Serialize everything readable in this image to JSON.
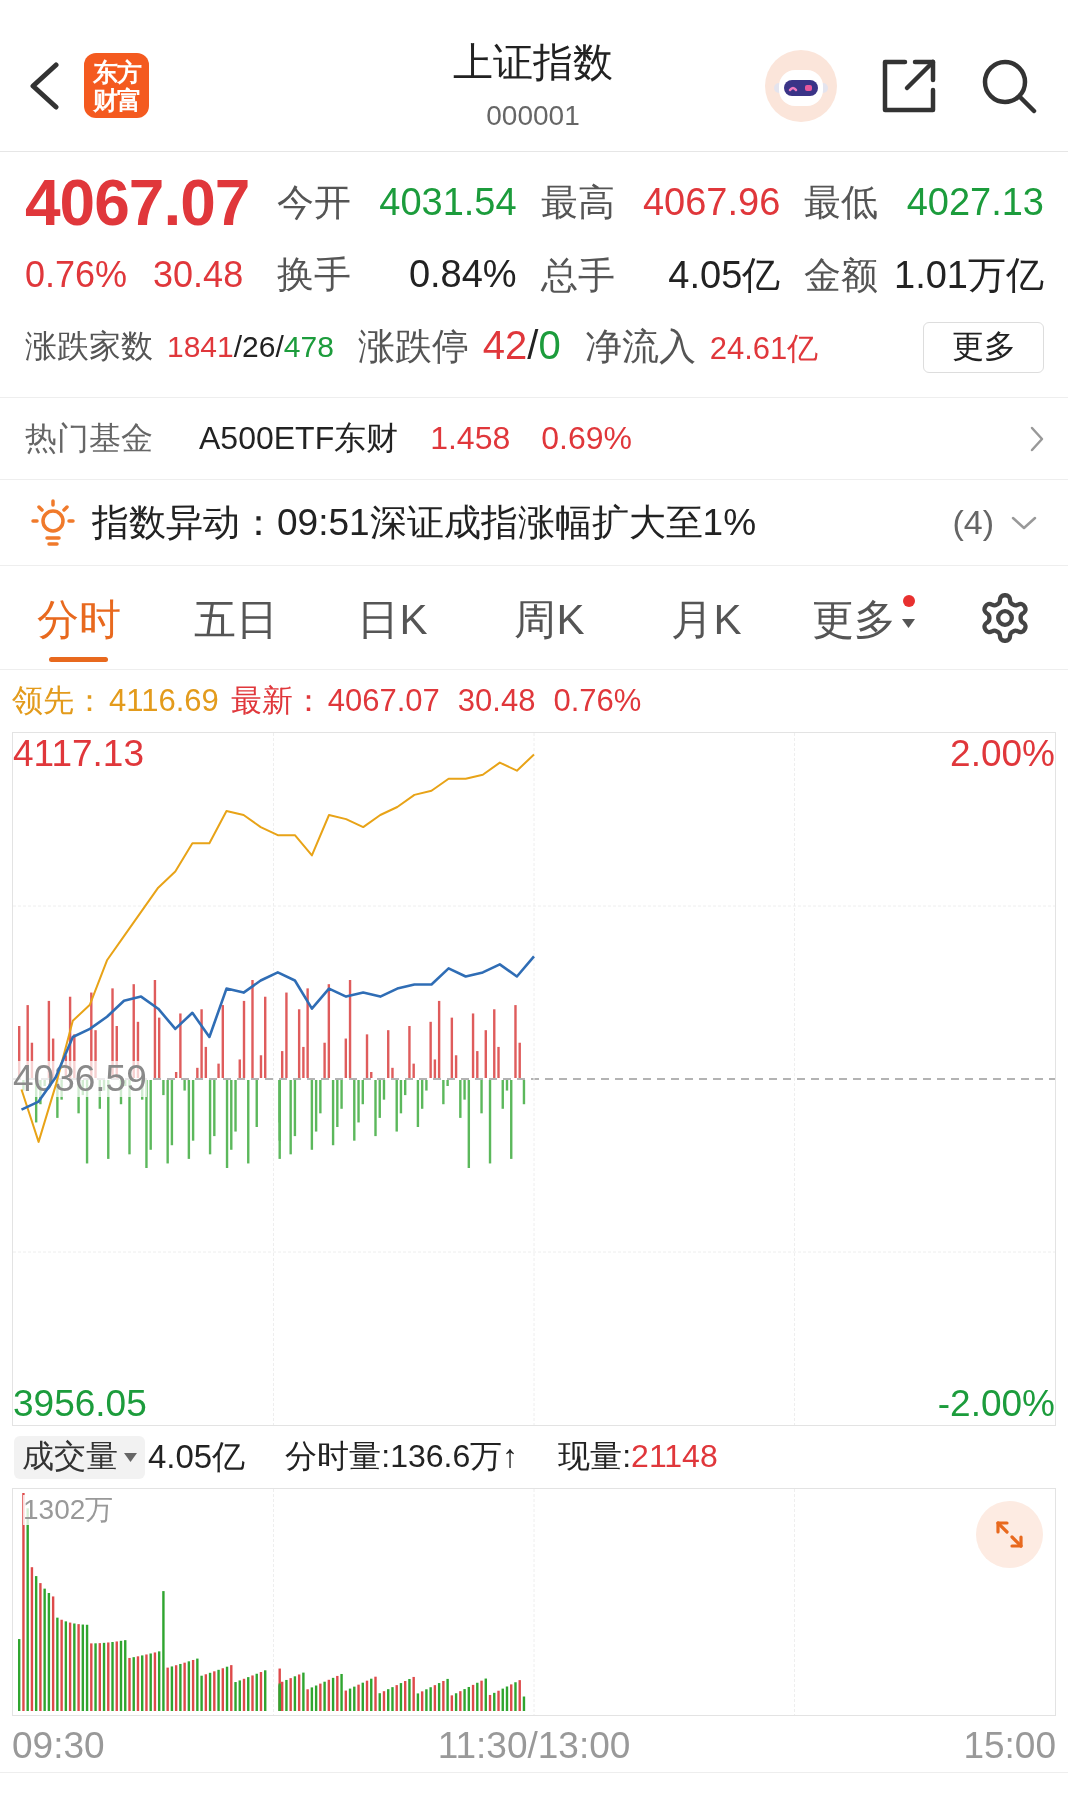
{
  "header": {
    "logo": [
      "东方",
      "财富"
    ],
    "title": "上证指数",
    "code": "000001"
  },
  "quote": {
    "price": "4067.07",
    "change_pct": "0.76%",
    "change": "30.48",
    "color": "#e0373b",
    "stats": [
      {
        "label": "今开",
        "value": "4031.54",
        "color": "#1c9c3c"
      },
      {
        "label": "最高",
        "value": "4067.96",
        "color": "#e0373b"
      },
      {
        "label": "最低",
        "value": "4027.13",
        "color": "#1c9c3c"
      },
      {
        "label": "换手",
        "value": "0.84%",
        "color": "#222222"
      },
      {
        "label": "总手",
        "value": "4.05亿",
        "color": "#222222"
      },
      {
        "label": "金额",
        "value": "1.01万亿",
        "color": "#222222"
      }
    ],
    "breadth": [
      {
        "label": "涨跌家数",
        "parts": [
          {
            "text": "1841",
            "color": "#e0373b"
          },
          {
            "text": "/26/",
            "color": "#222222"
          },
          {
            "text": "478",
            "color": "#1c9c3c"
          }
        ]
      },
      {
        "label": "涨跌停",
        "parts": [
          {
            "text": "42",
            "color": "#e0373b"
          },
          {
            "text": "/",
            "color": "#222222"
          },
          {
            "text": "0",
            "color": "#1c9c3c"
          }
        ]
      },
      {
        "label": "净流入",
        "parts": [
          {
            "text": "24.61亿",
            "color": "#e0373b"
          }
        ]
      }
    ],
    "more_button": "更多"
  },
  "hot_fund": {
    "label": "热门基金",
    "name": "A500ETF东财",
    "price": "1.458",
    "change": "0.69%",
    "color": "#e0373b"
  },
  "alert": {
    "text": "指数异动：09:51深证成指涨幅扩大至1%",
    "count": "(4)",
    "expanded": false
  },
  "tabs": [
    {
      "label": "分时",
      "kind": "view",
      "selected": true,
      "notice": false
    },
    {
      "label": "五日",
      "kind": "view",
      "selected": false,
      "notice": false
    },
    {
      "label": "日K",
      "kind": "view",
      "selected": false,
      "notice": false
    },
    {
      "label": "周K",
      "kind": "view",
      "selected": false,
      "notice": false
    },
    {
      "label": "月K",
      "kind": "view",
      "selected": false,
      "notice": false
    },
    {
      "label": "更多",
      "kind": "menu",
      "selected": false,
      "notice": true
    }
  ],
  "chart": {
    "legend": [
      {
        "values": [
          "4116.69"
        ],
        "color": "#e39b1c"
      },
      {
        "values": [
          "4067.07",
          "30.48",
          "0.76%"
        ],
        "color": "#e0373b"
      }
    ],
    "chart_data": {
      "type": "line",
      "categories": [
        null,
        null,
        null,
        null,
        null,
        null,
        null,
        null,
        null,
        null,
        null,
        null,
        null,
        null,
        null,
        null,
        null,
        null,
        null,
        null,
        null,
        null,
        null,
        null,
        null,
        null,
        null,
        null,
        null,
        null,
        null,
        null,
        null,
        null,
        null,
        null,
        null,
        null,
        null,
        null,
        null,
        null,
        null,
        null,
        null,
        null,
        null,
        null,
        null,
        null,
        null,
        null,
        null,
        null,
        null,
        null,
        null,
        null,
        null,
        null,
        null
      ],
      "series": [
        {
          "name": "领先：",
          "color": "#e8a317",
          "values": [
            4034,
            4021,
            4035,
            4051,
            4055,
            4066,
            4072,
            4078,
            4084,
            4088,
            4095,
            4095,
            4103,
            4102,
            4099,
            4097,
            4097,
            4092,
            4102,
            4101,
            4099,
            4102,
            4104,
            4107,
            4108,
            4111,
            4111,
            4112,
            4115,
            4113,
            4117,
            null,
            null,
            null,
            null,
            null,
            null,
            null,
            null,
            null,
            null,
            null,
            null,
            null,
            null,
            null,
            null,
            null,
            null,
            null,
            null,
            null,
            null,
            null,
            null,
            null,
            null,
            null,
            null,
            null,
            null
          ]
        },
        {
          "name": "最新：",
          "color": "#2f6db5",
          "values": [
            4029,
            4031,
            4037,
            4047,
            4049,
            4052,
            4056,
            4057,
            4054,
            4049,
            4053,
            4047,
            4059,
            4058,
            4061,
            4063,
            4061,
            4054,
            4059,
            4057,
            4058,
            4057,
            4059,
            4060,
            4060,
            4064,
            4062,
            4063,
            4065,
            4062,
            4067,
            null,
            null,
            null,
            null,
            null,
            null,
            null,
            null,
            null,
            null,
            null,
            null,
            null,
            null,
            null,
            null,
            null,
            null,
            null,
            null,
            null,
            null,
            null,
            null,
            null,
            null,
            null,
            null,
            null,
            null
          ]
        }
      ],
      "ylim": [
        3950.85,
        4122.33
      ],
      "yticks": [
        {
          "value": 3956.05,
          "label": "3956.05"
        },
        {
          "value": 4036.59,
          "label": "4036.59"
        },
        {
          "value": 4117.13,
          "label": "4117.13"
        }
      ]
    },
    "pct_labels": [
      "2.00%",
      "-2.00%"
    ],
    "time_axis": [
      "09:30",
      "11:30/13:00",
      "15:00"
    ]
  },
  "volume": {
    "selector": "成交量",
    "total": "4.05亿",
    "interval": "分时量:136.6万↑",
    "current": {
      "label": "现量:",
      "value": "21148",
      "color": "#e0373b"
    },
    "scale_label": "1302万"
  }
}
